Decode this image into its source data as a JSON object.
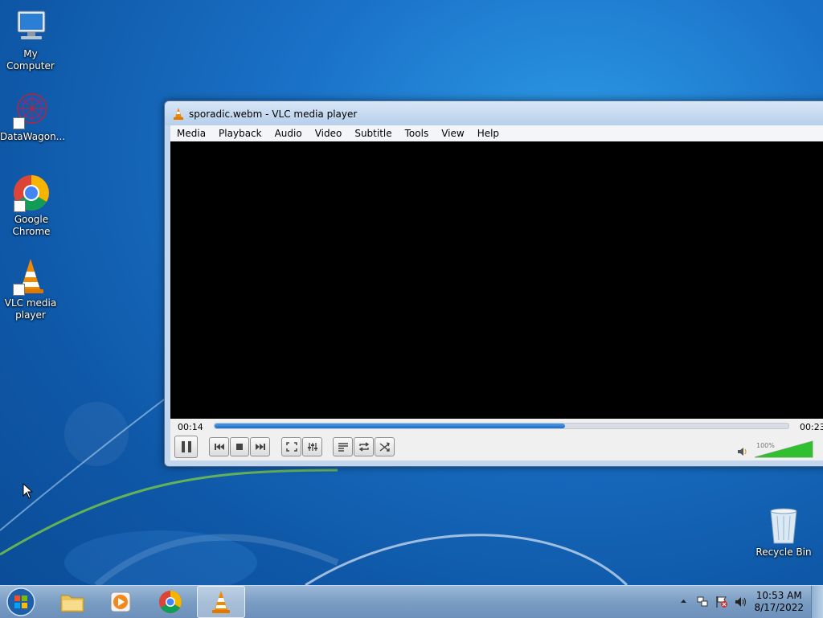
{
  "desktop": {
    "icons": [
      {
        "label": "My Computer"
      },
      {
        "label": "DataWagon..."
      },
      {
        "label": "Google Chrome"
      },
      {
        "label": "VLC media player"
      },
      {
        "label": "Recycle Bin"
      }
    ]
  },
  "vlc": {
    "title": "sporadic.webm - VLC media player",
    "menu": [
      "Media",
      "Playback",
      "Audio",
      "Video",
      "Subtitle",
      "Tools",
      "View",
      "Help"
    ],
    "time_elapsed": "00:14",
    "time_total": "00:23",
    "progress": 0.61,
    "volume_label": "100%",
    "volume": 1.0,
    "accent": "#1e6bc6"
  },
  "taskbar": {
    "items": [
      "start-orb",
      "file-explorer",
      "windows-media-player",
      "google-chrome",
      "vlc-media-player"
    ],
    "clock_time": "10:53 AM",
    "clock_date": "8/17/2022"
  }
}
